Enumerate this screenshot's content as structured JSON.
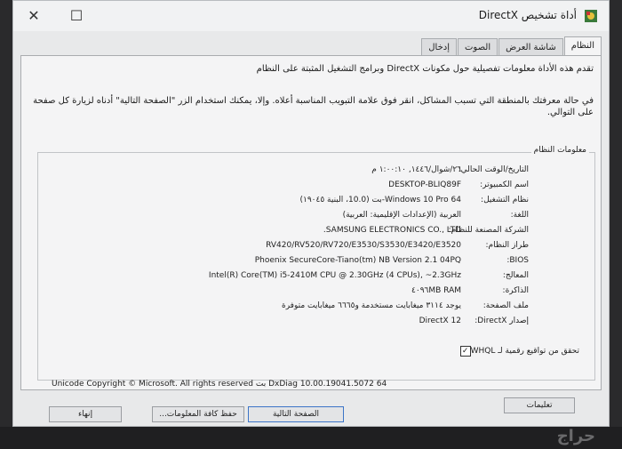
{
  "window": {
    "title": "أداة تشخيص DirectX"
  },
  "controls": {
    "close": "✕",
    "maximize": "☐"
  },
  "tabs": [
    "النظام",
    "شاشة العرض",
    "الصوت",
    "إدخال"
  ],
  "intro": {
    "line1": "تقدم هذه الأداة معلومات تفصيلية حول مكونات DirectX وبرامج التشغيل المثبتة على النظام",
    "line2": "في حالة معرفتك بالمنطقة التي تسبب المشاكل، انقر فوق علامة التبويب المناسبة أعلاه. وإلا، يمكنك استخدام الزر \"الصفحة التالية\" أدناه لزيارة كل صفحة على التوالي."
  },
  "system_info": {
    "group_label": "معلومات النظام",
    "rows": [
      {
        "label": "التاريخ/الوقت الحالي:",
        "value": "٢٦/شوال/١٤٤٦, ١:٠٠:١٠ م"
      },
      {
        "label": "اسم الكمبيوتر:",
        "value": "DESKTOP-BLIQ89F"
      },
      {
        "label": "نظام التشغيل:",
        "value": "Windows 10 Pro 64-بت (10.0، البنية ١٩٠٤٥)"
      },
      {
        "label": "اللغة:",
        "value": "العربية (الإعدادات الإقليمية: العربية)"
      },
      {
        "label": "الشركة المصنعة للنظام:",
        "value": "SAMSUNG ELECTRONICS CO., LTD."
      },
      {
        "label": "طراز النظام:",
        "value": "RV420/RV520/RV720/E3530/S3530/E3420/E3520"
      },
      {
        "label": "BIOS:",
        "value": "Phoenix SecureCore-Tiano(tm) NB Version 2.1 04PQ"
      },
      {
        "label": "المعالج:",
        "value": "Intel(R) Core(TM) i5-2410M CPU @ 2.30GHz (4 CPUs), ~2.3GHz"
      },
      {
        "label": "الذاكرة:",
        "value": "٤٠٩٦MB RAM"
      },
      {
        "label": "ملف الصفحة:",
        "value": "يوجد ٣١١٤ ميغابايت مستخدمة و٦٦٦٥ ميغابايت متوفرة"
      },
      {
        "label": "إصدار DirectX:",
        "value": "DirectX 12"
      }
    ]
  },
  "whql": {
    "label": "تحقق من تواقيع رقمية لـ WHQL",
    "checked": "✓"
  },
  "copyright": "Unicode  Copyright © Microsoft. All rights reserved بت DxDiag 10.00.19041.5072 64",
  "buttons": {
    "help": "تعليمات",
    "next": "الصفحة التالية",
    "save": "حفظ كافة المعلومات...",
    "exit": "إنهاء"
  },
  "watermark": "حراج"
}
